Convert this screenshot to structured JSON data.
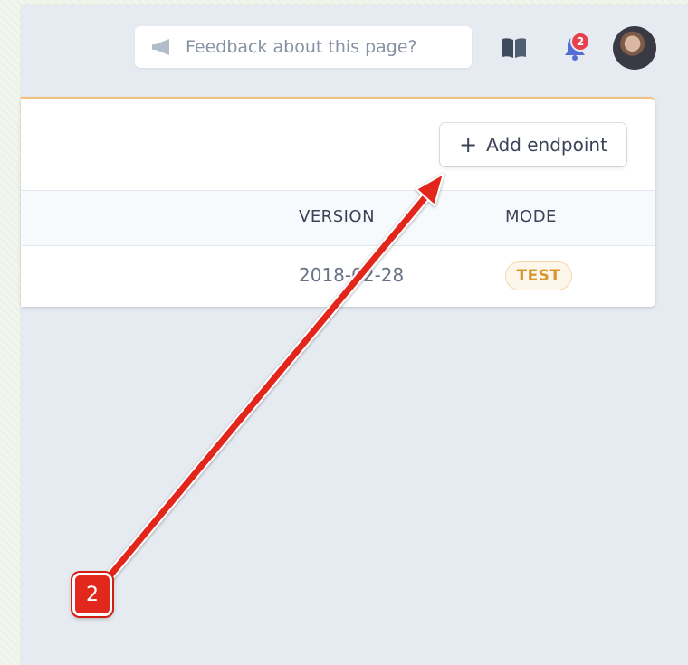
{
  "topbar": {
    "feedback_text": "Feedback about this page?",
    "notification_count": "2"
  },
  "card": {
    "add_button_label": "Add endpoint",
    "add_button_icon": "+",
    "columns": [
      "VERSION",
      "MODE"
    ],
    "rows": [
      {
        "version": "2018-02-28",
        "mode": "TEST"
      }
    ]
  },
  "annotation": {
    "step_number": "2",
    "color": "#e2281c"
  },
  "colors": {
    "accent": "#f2c27c",
    "test_badge": "#d8962e",
    "notification": "#e5424d",
    "bell": "#556cd6"
  }
}
